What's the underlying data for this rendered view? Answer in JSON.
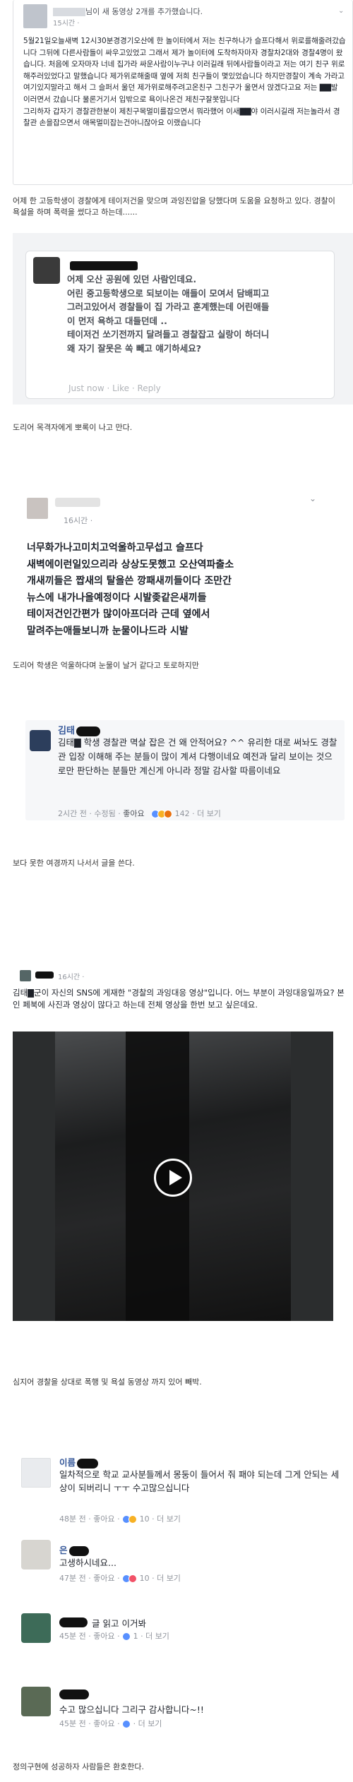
{
  "post1": {
    "author_suffix": "님이 새 동영상 2개를 추가했습니다.",
    "time": "15시간 ·",
    "body": "5월21일오늘새벽 12시30분경경기오산에 한 놀이터에서 저는 친구하나가 슬프다해서 위로를해줄려갔습니다 그뒤에 다른사람들이 싸우고있었고 그래서 제가 놀이터에 도착하자마자 경찰차2대와 경찰4명이 왔습니다. 처음에 오자마자 너네 집가라 싸운사람이누구냐 이러길래 뒤에사람들이라고 저는 여기 친구 위로해주러있었다고 말했습니다 제가위로해줄때 옆에 저희 친구들이 몇있었습니다 하지만경찰이 계속 가라고 여기있지말라고 해서 그 슬퍼서 울던 제가위로해주려고온친구 그친구가 울면서 앉겠다고요 저는 ▇▇발 이러면서 갔습니다 물론거기서 입밖으로 욕이나온건 제친구잘못입니다\n그리하자 갑자기 경찰관한분이 제친구목멀미를잡으면서 뭐라했어 이새▇▇야 이러시길래 저는놀라서 경찰관 손을잡으면서 애목멀미잡는건아니잖아요 이랬습니다"
  },
  "caption1": "어제 한 고등학생이 경찰에게 테이저건을 맞으며 과잉진압을 당했다며 도움을 요청하고 있다. 경찰이 욕설을 하며 폭력을 썼다고 하는데......",
  "comment1": {
    "lines": [
      "어제 오산 공원에 있던 사람인데요.",
      "어린 중고등학생으로 되보이는 애들이 모여서 담배피고",
      "그러고있어서 경찰들이 집 가라고 훈계했는데 어린애들",
      "이 먼저 욕하고 대들던데 ..",
      "테이저건 쏘기전까지 달려들고 경찰잡고 실랑이 하더니",
      "왜 자기 잘못은 쏙 빼고 얘기하세요?"
    ],
    "actions": "Just now · Like · Reply"
  },
  "caption2": "도리어 목격자에게 뽀록이 나고 만다.",
  "post2": {
    "time": "16시간 ·",
    "lines": [
      "너무화가나고미치고억울하고무섭고 슬프다",
      "새벽에이런일있으리라 상상도못했고 오산역파출소",
      "개새끼들은 짭새의 탈을쓴 깡패새끼들이다 조만간",
      "뉴스에 내가나올예정이다 시발좆같은새끼들",
      "테이저건인간편가 많이아프더라 근데 옆에서",
      "말려주는애들보니까 눈물이나드라 시발"
    ]
  },
  "caption3": "도리어 학생은 억울하다며 눈물이 날거 같다고 토로하지만",
  "comment2": {
    "name": "김태",
    "body": "김태▇ 학생 경찰관 멱살 잡은 건 왜 안적어요? ^^ 유리한 대로 써놔도 경찰관 입장 이해해 주는 분들이 많이 계셔 다행이네요 예전과 달리 보이는 것으로만 판단하는 분들만 계신게 아니라 정말 감사할 따름이네요",
    "time": "2시간 전 · 수정됨 ·",
    "like": "좋아요",
    "react_count": "142",
    "more": "· 더 보기"
  },
  "caption4": "보다 못한 여경까지 나서서 글을 쓴다.",
  "post3": {
    "time": "16시간 ·",
    "body": "김태▇군이 자신의 SNS에 게재한 \"경찰의 과잉대응 영상\"입니다. 어느 부분이 과잉대응일까요? 본인 페북에 사진과 영상이 많다고 하는데 전체 영상을 한번 보고 싶은데요."
  },
  "caption5": "심지어 경찰을 상대로 폭행 및 욕설 동영상 까지 있어 빼박.",
  "comments": [
    {
      "name": "이름",
      "body": "일차적으로 학교 교사분들께서 몽둥이 들어서 줘 패야 되는데 그게 안되는 세상이 되버리니 ㅜㅜ 수고많으십니다",
      "meta": "48분 전 · 좋아요 ·",
      "count": "10",
      "more": "· 더 보기"
    },
    {
      "name": "은",
      "body": "고생하시네요...",
      "meta": "47분 전 · 좋아요 ·",
      "count": "10",
      "more": "· 더 보기"
    },
    {
      "name": "",
      "body": "글 읽고 이거봐",
      "meta": "45분 전 · 좋아요 ·",
      "count": "1",
      "more": "· 더 보기"
    },
    {
      "name": "",
      "body": "수고 많으십니다 그리구 감사합니다~!!",
      "meta": "45분 전 · 좋아요 ·",
      "count": "",
      "more": "· 더 보기"
    }
  ],
  "caption6": "정의구현에 성공하자 사람들은 환호한다."
}
